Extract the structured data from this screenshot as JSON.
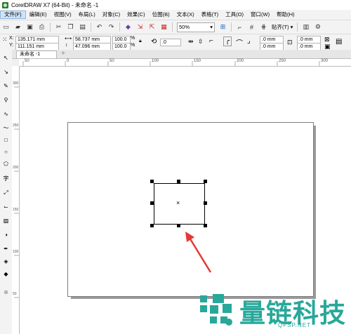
{
  "window": {
    "title": "CorelDRAW X7 (64-Bit) - 未命名 -1"
  },
  "menu": [
    {
      "label": "文件(F)"
    },
    {
      "label": "编辑(E)"
    },
    {
      "label": "视图(V)"
    },
    {
      "label": "布局(L)"
    },
    {
      "label": "对象(C)"
    },
    {
      "label": "效果(C)"
    },
    {
      "label": "位图(B)"
    },
    {
      "label": "文本(X)"
    },
    {
      "label": "表格(T)"
    },
    {
      "label": "工具(O)"
    },
    {
      "label": "窗口(W)"
    },
    {
      "label": "帮助(H)"
    }
  ],
  "toolbar": {
    "zoom": "50%",
    "snap_label": "贴齐(T)"
  },
  "properties": {
    "x_label": "X:",
    "x_value": "135.171 mm",
    "y_label": "Y:",
    "y_value": "111.151 mm",
    "width_value": "58.737 mm",
    "height_value": "47.096 mm",
    "scale_w": "100.0",
    "scale_h": "100.0",
    "pct": "%",
    "rotation": ".0",
    "corner_1": ".0 mm",
    "corner_2": ".0 mm",
    "corner_3": ".0 mm",
    "corner_4": ".0 mm"
  },
  "tabs": [
    {
      "label": "未命名 -1"
    }
  ],
  "ruler": {
    "h_ticks": [
      "50",
      "0",
      "50",
      "100",
      "150",
      "200",
      "250",
      "300"
    ],
    "v_ticks": [
      "300",
      "250",
      "200",
      "150",
      "100",
      "50"
    ]
  },
  "watermark": {
    "text": "量链科技",
    "url": "QFSP.NET"
  },
  "colors": {
    "accent": "#28a89a",
    "arrow": "#e53935"
  }
}
